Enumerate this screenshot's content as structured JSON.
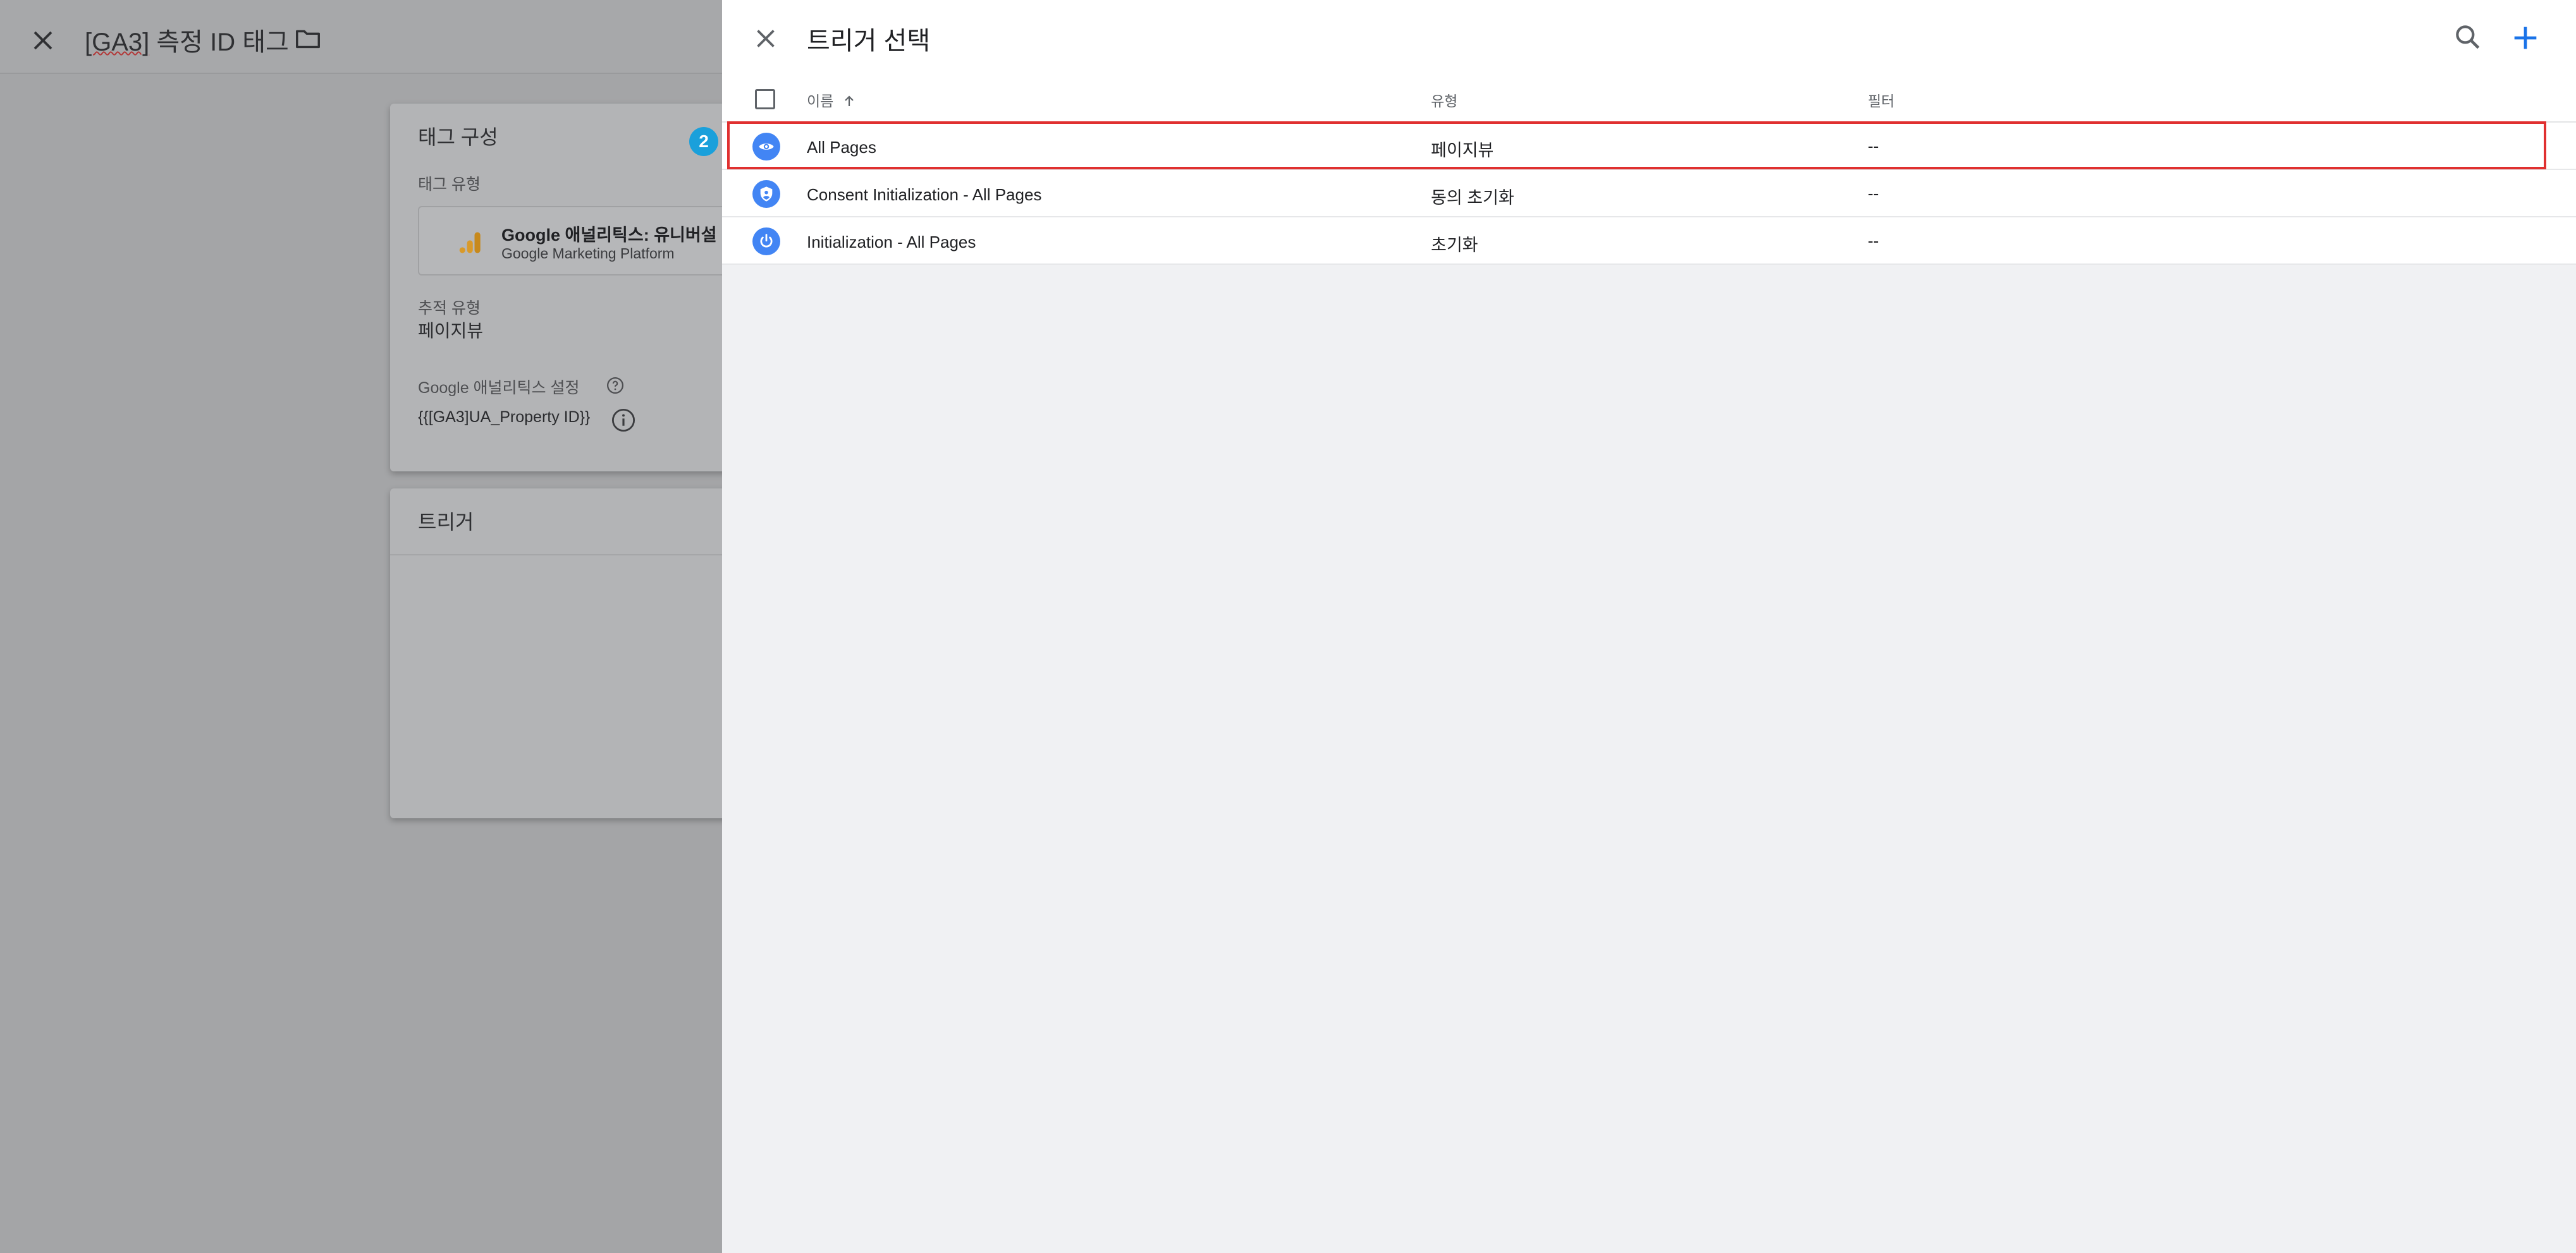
{
  "background_editor": {
    "title_prefix": "[GA3]",
    "title_rest": " 측정 ID 태그",
    "tag_config": {
      "card_title": "태그 구성",
      "tag_type_label": "태그 유형",
      "tag_type_name": "Google 애널리틱스: 유니버설",
      "tag_type_sub": "Google Marketing Platform",
      "tracking_type_label": "추적 유형",
      "tracking_type_value": "페이지뷰",
      "ga_settings_label": "Google 애널리틱스 설정",
      "ga_settings_value": "{{[GA3]UA_Property ID}}"
    },
    "trigger_card_title": "트리거",
    "step_badge": "2"
  },
  "trigger_panel": {
    "title": "트리거 선택",
    "columns": {
      "name": "이름",
      "type": "유형",
      "filter": "필터"
    },
    "rows": [
      {
        "name": "All Pages",
        "type": "페이지뷰",
        "filter": "--",
        "icon": "eye-icon",
        "highlighted": true
      },
      {
        "name": "Consent Initialization - All Pages",
        "type": "동의 초기화",
        "filter": "--",
        "icon": "shield-icon",
        "highlighted": false
      },
      {
        "name": "Initialization - All Pages",
        "type": "초기화",
        "filter": "--",
        "icon": "power-icon",
        "highlighted": false
      }
    ]
  },
  "colors": {
    "accent_blue": "#4285f4",
    "add_blue": "#1a73e8",
    "highlight_red": "#e03030",
    "badge_blue": "#1aa0db"
  }
}
